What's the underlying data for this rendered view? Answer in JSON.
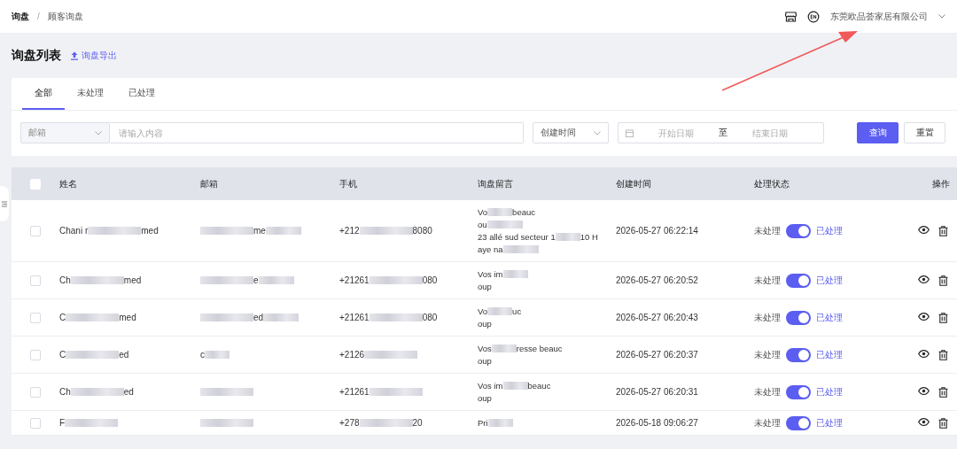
{
  "breadcrumb": [
    {
      "label": "询盘",
      "current": false
    },
    {
      "label": "顾客询盘",
      "current": true
    }
  ],
  "breadcrumb_separator": "/",
  "topbar": {
    "company": "东莞欧品荟家居有限公司"
  },
  "page_title": "询盘列表",
  "export_link": "询盘导出",
  "tabs": [
    {
      "label": "全部",
      "selected": true
    },
    {
      "label": "未处理",
      "selected": false
    },
    {
      "label": "已处理",
      "selected": false
    }
  ],
  "filters": {
    "field_select": "邮箱",
    "search": {
      "placeholder": "请输入内容"
    },
    "time_select": "创建时间",
    "start": {
      "placeholder": "开始日期"
    },
    "separator": "至",
    "end": {
      "placeholder": "结束日期"
    },
    "buttons": [
      {
        "label": "查询",
        "kind": "primary"
      },
      {
        "label": "重置",
        "kind": "default"
      }
    ]
  },
  "table": {
    "select_all": {
      "checked": false
    },
    "columns": [
      "姓名",
      "邮箱",
      "手机",
      "询盘留言",
      "创建时间",
      "处理状态",
      "操作"
    ],
    "rows": [
      {
        "checked": false,
        "name": [
          {
            "text": "Chani r"
          },
          {
            "redacted": true
          },
          {
            "text": "med"
          }
        ],
        "email": [
          {
            "redacted": true
          },
          {
            "text": "me"
          },
          {
            "redacted": true
          }
        ],
        "phone": [
          {
            "text": "+212"
          },
          {
            "redacted": true
          },
          {
            "text": "8080"
          }
        ],
        "message": [
          [
            {
              "text": "Vo"
            },
            {
              "redacted": true
            },
            {
              "text": "beauc"
            }
          ],
          [
            {
              "text": "ou"
            },
            {
              "redacted": true
            }
          ],
          [
            {
              "text": "23 allé sud secteur 1"
            },
            {
              "redacted": true
            },
            {
              "text": "10 H"
            }
          ],
          [
            {
              "text": "aye na"
            },
            {
              "redacted": true
            }
          ]
        ],
        "created": "2026-05-27 06:22:14",
        "off_label": "未处理",
        "on": true,
        "on_label": "已处理"
      },
      {
        "checked": false,
        "name": [
          {
            "text": "Ch"
          },
          {
            "redacted": true
          },
          {
            "text": "med"
          }
        ],
        "email": [
          {
            "redacted": true
          },
          {
            "text": "e"
          },
          {
            "redacted": true
          }
        ],
        "phone": [
          {
            "text": "+21261"
          },
          {
            "redacted": true
          },
          {
            "text": "080"
          }
        ],
        "message": [
          [
            {
              "text": "Vos im"
            },
            {
              "redacted": true
            }
          ],
          [
            {
              "text": "oup"
            }
          ]
        ],
        "created": "2026-05-27 06:20:52",
        "off_label": "未处理",
        "on": true,
        "on_label": "已处理"
      },
      {
        "checked": false,
        "name": [
          {
            "text": "C"
          },
          {
            "redacted": true
          },
          {
            "text": "med"
          }
        ],
        "email": [
          {
            "redacted": true
          },
          {
            "text": "ed"
          },
          {
            "redacted": true
          }
        ],
        "phone": [
          {
            "text": "+21261"
          },
          {
            "redacted": true
          },
          {
            "text": "080"
          }
        ],
        "message": [
          [
            {
              "text": "Vo"
            },
            {
              "redacted": true
            },
            {
              "text": "uc"
            }
          ],
          [
            {
              "text": "oup"
            }
          ]
        ],
        "created": "2026-05-27 06:20:43",
        "off_label": "未处理",
        "on": true,
        "on_label": "已处理"
      },
      {
        "checked": false,
        "name": [
          {
            "text": "C"
          },
          {
            "redacted": true
          },
          {
            "text": "ed"
          }
        ],
        "email": [
          {
            "text": "c"
          },
          {
            "redacted": true
          }
        ],
        "phone": [
          {
            "text": "+2126"
          },
          {
            "redacted": true
          }
        ],
        "message": [
          [
            {
              "text": "Vos"
            },
            {
              "redacted": true
            },
            {
              "text": "resse beauc"
            }
          ],
          [
            {
              "text": "oup"
            }
          ]
        ],
        "created": "2026-05-27 06:20:37",
        "off_label": "未处理",
        "on": true,
        "on_label": "已处理"
      },
      {
        "checked": false,
        "name": [
          {
            "text": "Ch"
          },
          {
            "redacted": true
          },
          {
            "text": "ed"
          }
        ],
        "email": [
          {
            "redacted": true
          }
        ],
        "phone": [
          {
            "text": "+21261"
          },
          {
            "redacted": true
          }
        ],
        "message": [
          [
            {
              "text": "Vos im"
            },
            {
              "redacted": true
            },
            {
              "text": "beauc"
            }
          ],
          [
            {
              "text": "oup"
            }
          ]
        ],
        "created": "2026-05-27 06:20:31",
        "off_label": "未处理",
        "on": true,
        "on_label": "已处理"
      },
      {
        "checked": false,
        "name": [
          {
            "text": "F"
          },
          {
            "redacted": true
          }
        ],
        "email": [
          {
            "redacted": true
          }
        ],
        "phone": [
          {
            "text": "+278"
          },
          {
            "redacted": true
          },
          {
            "text": "20"
          }
        ],
        "message": [
          [
            {
              "text": "Pri"
            },
            {
              "redacted": true
            }
          ]
        ],
        "created": "2026-05-18 09:06:27",
        "off_label": "未处理",
        "on": true,
        "on_label": "已处理"
      }
    ]
  },
  "annotations": [
    {
      "kind": "arrow"
    }
  ]
}
